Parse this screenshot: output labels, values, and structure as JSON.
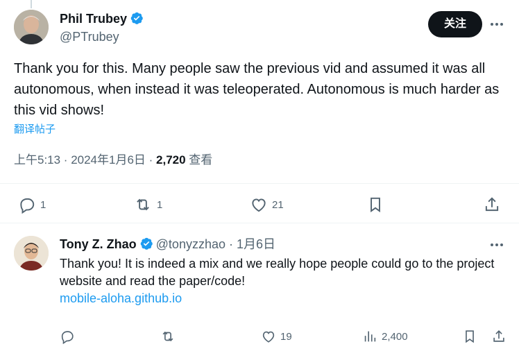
{
  "main_tweet": {
    "author_name": "Phil Trubey",
    "author_handle": "@PTrubey",
    "follow_label": "关注",
    "text": "Thank you for this. Many people saw the previous vid and assumed it was all autonomous, when instead it was teleoperated. Autonomous is much harder as this vid shows!",
    "translate_label": "翻译帖子",
    "timestamp": "上午5:13 · 2024年1月6日 · ",
    "views_count": "2,720",
    "views_label": " 查看",
    "actions": {
      "replies": "1",
      "retweets": "1",
      "likes": "21"
    }
  },
  "reply_tweet": {
    "author_name": "Tony Z. Zhao",
    "author_handle": "@tonyzzhao",
    "date": " · 1月6日",
    "text": "Thank you! It is indeed a mix and we really hope people could go to the project website and read the paper/code!",
    "link": "mobile-aloha.github.io",
    "actions": {
      "likes": "19",
      "views": "2,400"
    }
  },
  "colors": {
    "text_primary": "#0f1419",
    "text_secondary": "#536471",
    "accent": "#1d9bf0",
    "border": "#eff3f4"
  },
  "icons": [
    "verified-badge-icon",
    "more-icon",
    "reply-icon",
    "retweet-icon",
    "like-icon",
    "bookmark-icon",
    "share-icon",
    "analytics-icon"
  ]
}
